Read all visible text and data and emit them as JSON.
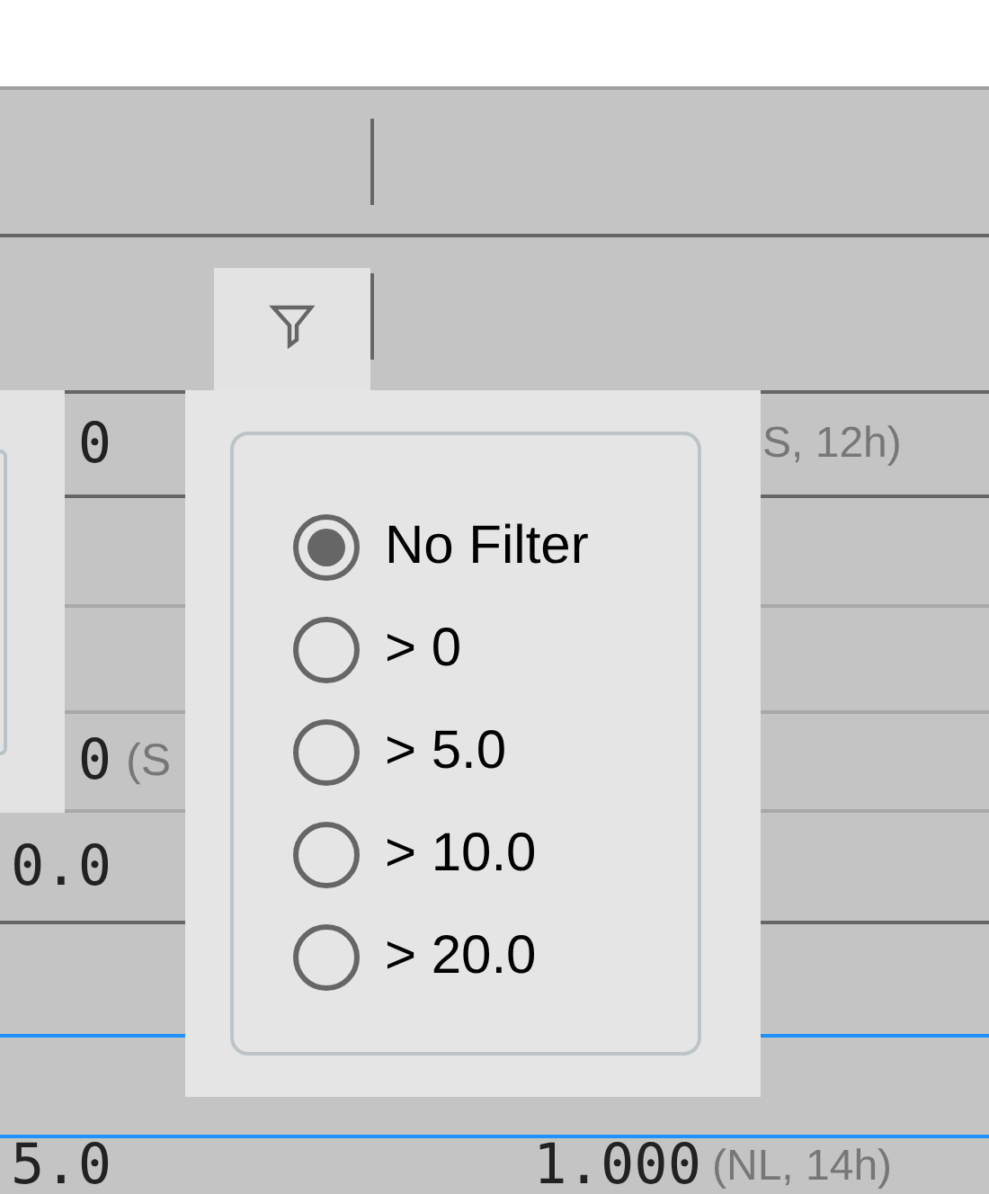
{
  "filter_popup": {
    "open": true,
    "options": [
      {
        "label": "No Filter",
        "selected": true
      },
      {
        "label": "> 0",
        "selected": false
      },
      {
        "label": "> 5.0",
        "selected": false
      },
      {
        "label": "> 10.0",
        "selected": false
      },
      {
        "label": "> 20.0",
        "selected": false
      }
    ]
  },
  "rows": [
    {
      "value": "0",
      "note_2": "S, 12h)",
      "selected": false,
      "group_end": true
    },
    {
      "selected": false,
      "group_end": false
    },
    {
      "selected": false,
      "group_end": false
    },
    {
      "value": "0",
      "note": "(S",
      "selected": false,
      "group_end": false
    },
    {
      "value": "0.0",
      "selected": false,
      "group_end": true
    },
    {
      "selected": false
    },
    {
      "selected": true
    },
    {
      "value": "5.0",
      "value_2": "1.000",
      "note_2": "(NL, 14h)",
      "selected": false
    }
  ]
}
